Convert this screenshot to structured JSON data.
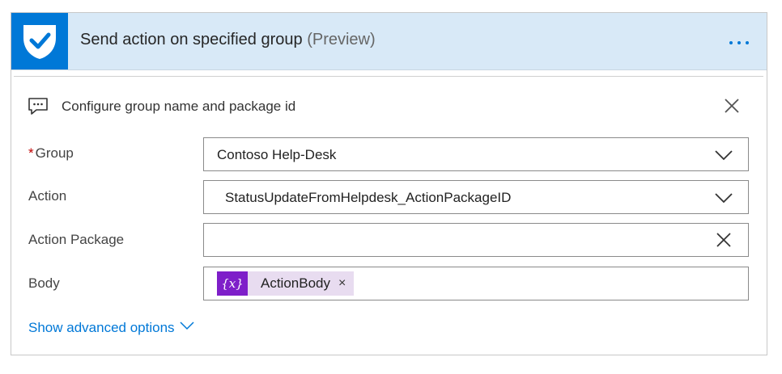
{
  "header": {
    "title": "Send action on specified group",
    "title_suffix": "(Preview)",
    "icon": "checkmark-shield-icon",
    "more_icon": "ellipsis-icon"
  },
  "config": {
    "icon": "comment-icon",
    "label": "Configure group name and package id",
    "close_icon": "close-icon"
  },
  "fields": {
    "group": {
      "required_marker": "*",
      "label": "Group",
      "value": "Contoso Help-Desk",
      "control": "dropdown"
    },
    "action": {
      "label": "Action",
      "value": "StatusUpdateFromHelpdesk_ActionPackageID",
      "control": "dropdown"
    },
    "action_package": {
      "label": "Action Package",
      "value": "",
      "control": "clearable-input"
    },
    "body": {
      "label": "Body",
      "token": {
        "icon_text": "{x}",
        "label": "ActionBody",
        "remove": "×"
      }
    }
  },
  "advanced": {
    "label": "Show advanced options"
  },
  "colors": {
    "accent": "#0078d7",
    "header_bg": "#d8e9f7",
    "token_bg": "#e8dcf0",
    "token_icon_bg": "#7e1fc9",
    "required": "#c00000"
  }
}
